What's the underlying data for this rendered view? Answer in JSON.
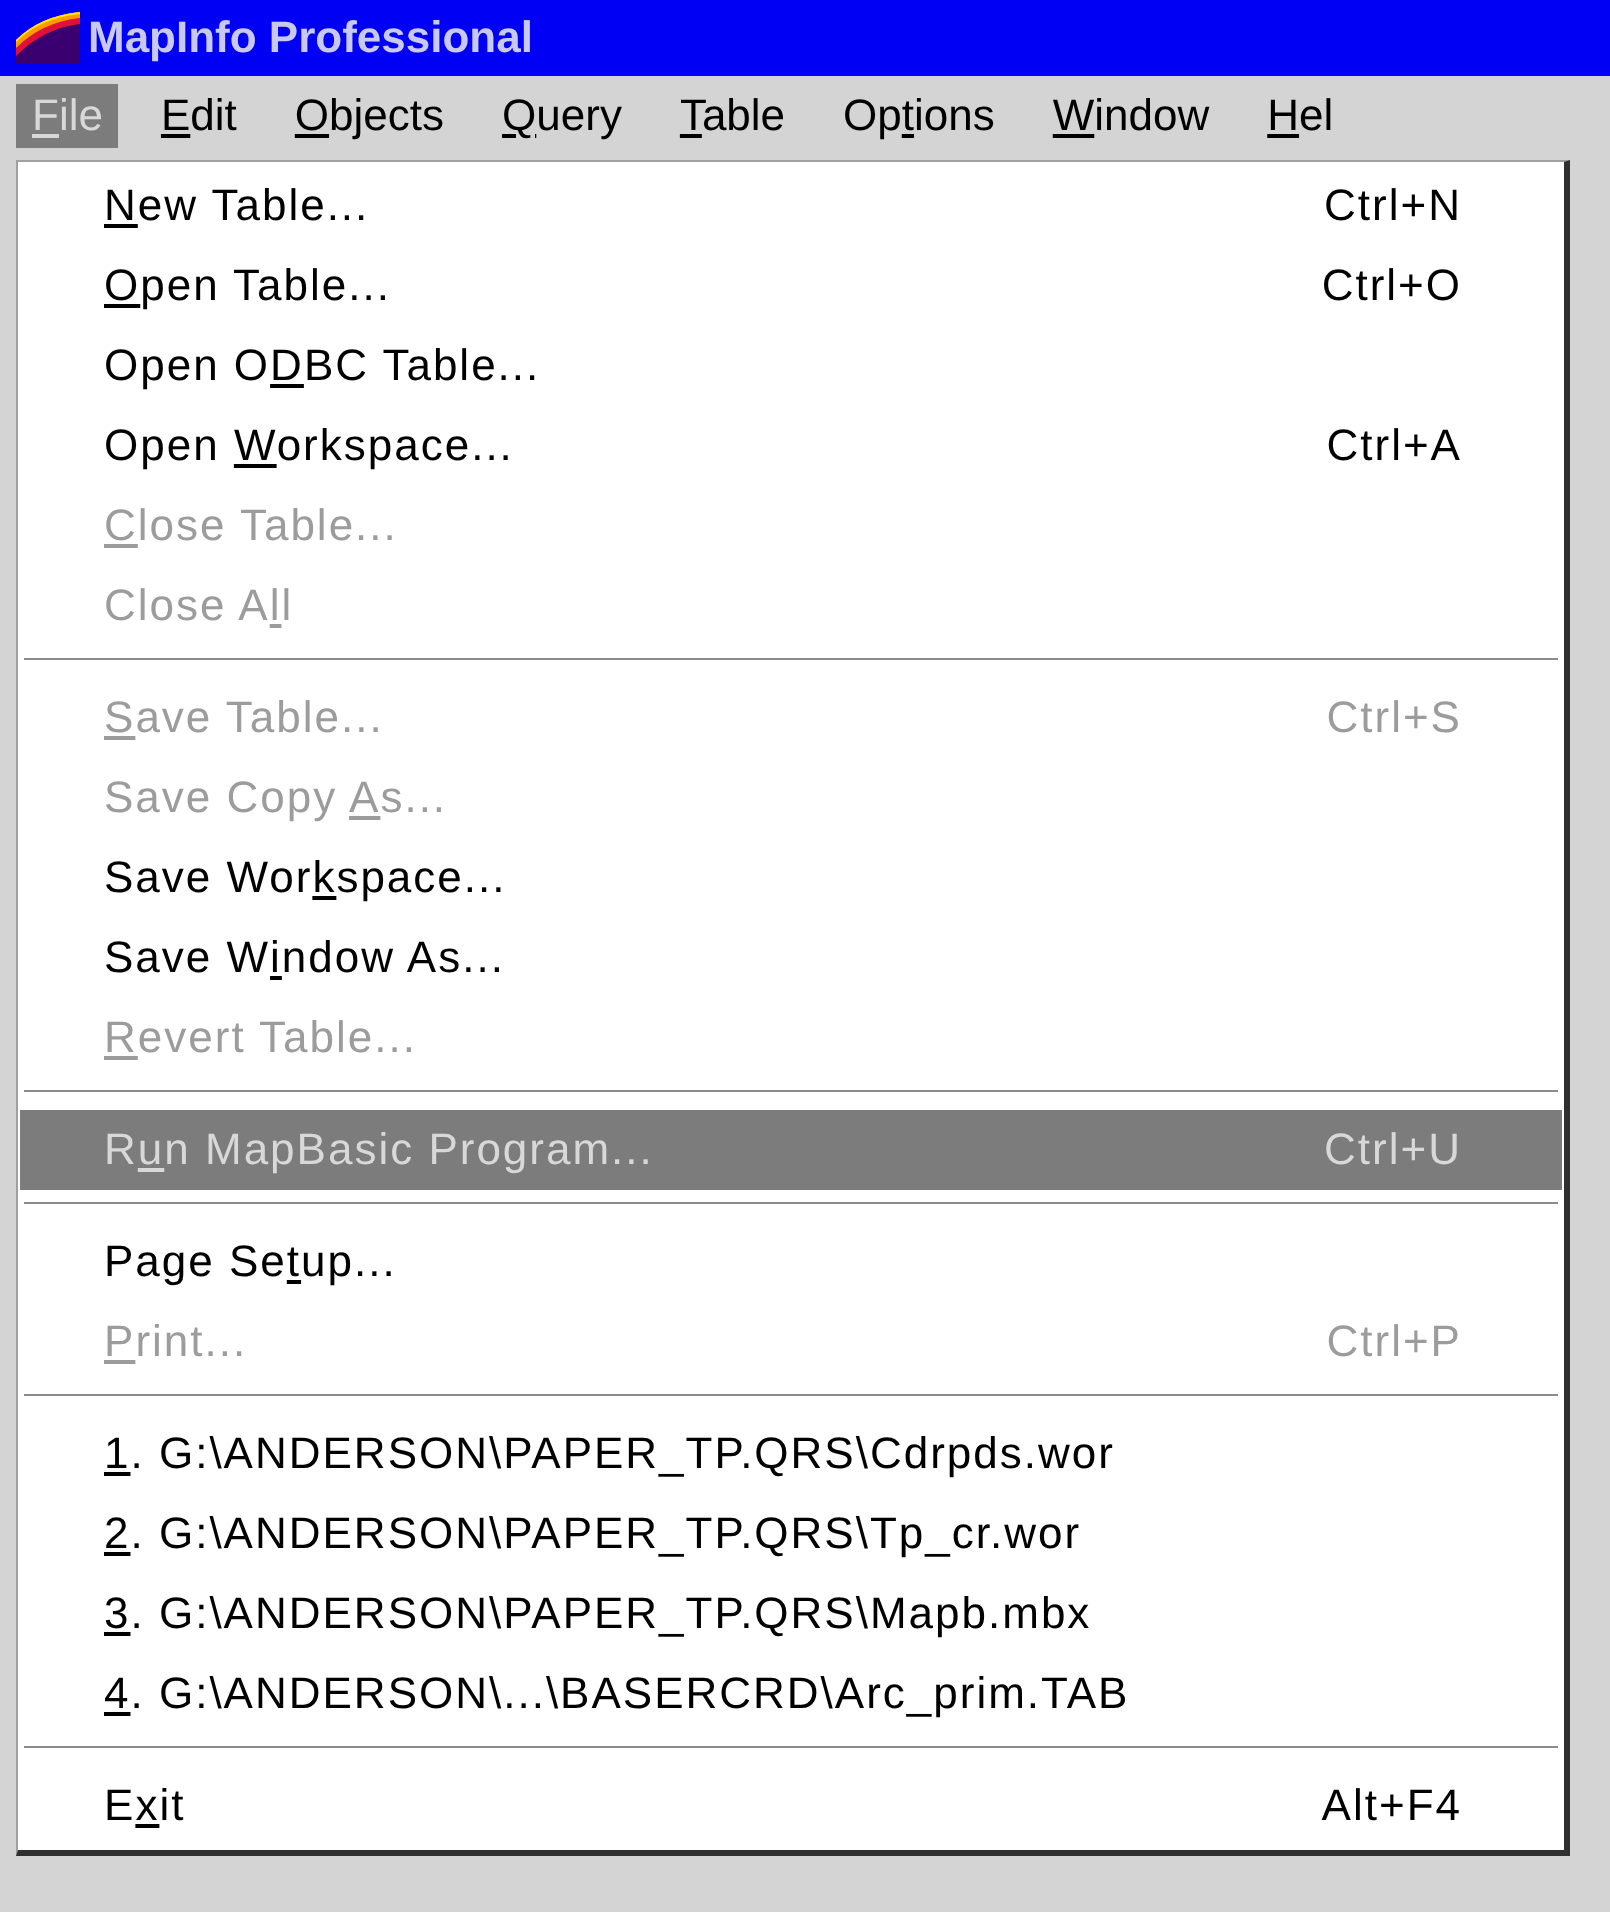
{
  "window": {
    "title": "MapInfo Professional"
  },
  "menu_bar": [
    {
      "key": "F",
      "post": "ile",
      "selected": true
    },
    {
      "key": "E",
      "post": "dit",
      "selected": false
    },
    {
      "key": "O",
      "post": "bjects",
      "selected": false
    },
    {
      "key": "Q",
      "post": "uery",
      "selected": false
    },
    {
      "key": "T",
      "post": "able",
      "selected": false
    },
    {
      "pre": "Op",
      "key": "t",
      "post": "ions",
      "selected": false
    },
    {
      "key": "W",
      "post": "indow",
      "selected": false
    },
    {
      "key": "H",
      "post": "el",
      "selected": false
    }
  ],
  "file_menu": [
    {
      "items": [
        {
          "key": "N",
          "post": "ew Table...",
          "shortcut": "Ctrl+N",
          "disabled": false,
          "selected": false
        },
        {
          "key": "O",
          "post": "pen Table...",
          "shortcut": "Ctrl+O",
          "disabled": false,
          "selected": false
        },
        {
          "pre": "Open O",
          "key": "D",
          "post": "BC Table...",
          "disabled": false,
          "selected": false
        },
        {
          "pre": "Open ",
          "key": "W",
          "post": "orkspace...",
          "shortcut": "Ctrl+A",
          "disabled": false,
          "selected": false
        },
        {
          "key": "C",
          "post": "lose Table...",
          "disabled": true,
          "selected": false
        },
        {
          "pre": "Close A",
          "key": "l",
          "post": "l",
          "disabled": true,
          "selected": false
        }
      ]
    },
    {
      "items": [
        {
          "key": "S",
          "post": "ave Table...",
          "shortcut": "Ctrl+S",
          "disabled": true,
          "selected": false
        },
        {
          "pre": "Save Copy ",
          "key": "A",
          "post": "s...",
          "disabled": true,
          "selected": false
        },
        {
          "pre": "Save Wor",
          "key": "k",
          "post": "space...",
          "disabled": false,
          "selected": false
        },
        {
          "pre": "Save W",
          "key": "i",
          "post": "ndow As...",
          "disabled": false,
          "selected": false
        },
        {
          "key": "R",
          "post": "evert Table...",
          "disabled": true,
          "selected": false
        }
      ]
    },
    {
      "items": [
        {
          "pre": "R",
          "key": "u",
          "post": "n MapBasic Program...",
          "shortcut": "Ctrl+U",
          "disabled": false,
          "selected": true
        }
      ]
    },
    {
      "items": [
        {
          "pre": "Page Se",
          "key": "t",
          "post": "up...",
          "disabled": false,
          "selected": false
        },
        {
          "key": "P",
          "post": "rint...",
          "shortcut": "Ctrl+P",
          "disabled": true,
          "selected": false
        }
      ]
    },
    {
      "items": [
        {
          "key": "1",
          "post": ". G:\\ANDERSON\\PAPER_TP.QRS\\Cdrpds.wor",
          "disabled": false,
          "selected": false
        },
        {
          "key": "2",
          "post": ". G:\\ANDERSON\\PAPER_TP.QRS\\Tp_cr.wor",
          "disabled": false,
          "selected": false
        },
        {
          "key": "3",
          "post": ". G:\\ANDERSON\\PAPER_TP.QRS\\Mapb.mbx",
          "disabled": false,
          "selected": false
        },
        {
          "key": "4",
          "post": ". G:\\ANDERSON\\...\\BASERCRD\\Arc_prim.TAB",
          "disabled": false,
          "selected": false
        }
      ]
    },
    {
      "items": [
        {
          "pre": "E",
          "key": "x",
          "post": "it",
          "shortcut": "Alt+F4",
          "disabled": false,
          "selected": false
        }
      ]
    }
  ]
}
